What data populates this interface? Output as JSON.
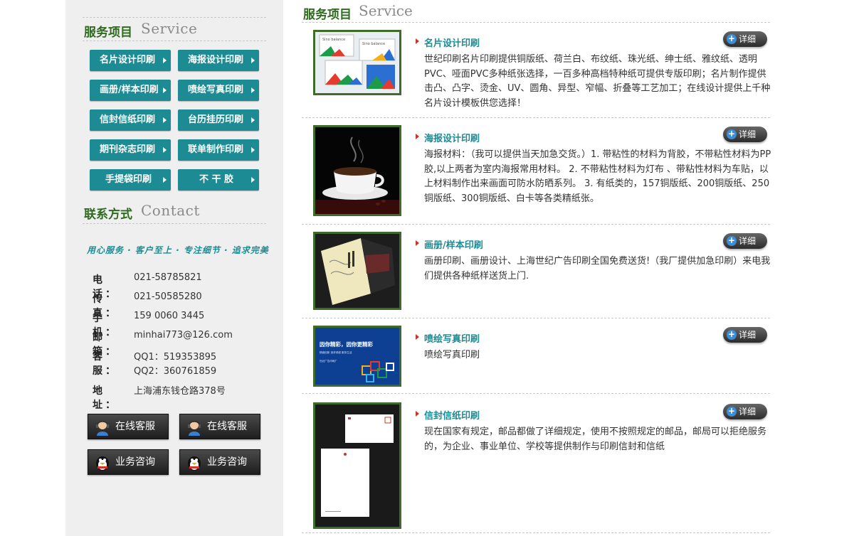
{
  "sidebar": {
    "services_cn": "服务项目",
    "services_en": "Service",
    "service_buttons": [
      "名片设计印刷",
      "海报设计印刷",
      "画册/样本印刷",
      "喷绘写真印刷",
      "信封信纸印刷",
      "台历挂历印刷",
      "期刊杂志印刷",
      "联单制作印刷",
      "手提袋印刷",
      "不 干 胶"
    ],
    "contact_cn": "联系方式",
    "contact_en": "Contact",
    "slogan": "用心服务 · 客户至上 · 专注细节 · 追求完美",
    "contact": {
      "phone_label": "电 话：",
      "phone": "021-58785821",
      "fax_label": "传 真：",
      "fax": "021-50585280",
      "mobile_label": "手 机：",
      "mobile": "159 0060 3445",
      "email_label": "邮 箱：",
      "email": "minhai773@126.com",
      "cs_label": "客 服：",
      "qq1": "QQ1：519353895",
      "qq2": "QQ2：360761859",
      "address_label": "地 址：",
      "address": "上海浦东钱仓路378号"
    },
    "cs_buttons": [
      "在线客服",
      "在线客服",
      "业务咨询",
      "业务咨询"
    ]
  },
  "main": {
    "head_cn": "服务项目",
    "head_en": "Service",
    "detail_label": "详细",
    "items": [
      {
        "title": "名片设计印刷",
        "desc": "世纪印刷名片印刷提供铜版纸、荷兰白、布纹纸、珠光纸、绅士纸、雅纹纸、透明PVC、哑面PVC多种纸张选择，一百多种高档特种纸可提供专版印刷；名片制作提供击凸、凸字、烫金、UV、圆角、异型、窄幅、折叠等工艺加工；在线设计提供上千种名片设计模板供您选择！"
      },
      {
        "title": "海报设计印刷",
        "desc": "海报材料：（我可以提供当天加急交货。）1. 带粘性的材料为背胶，不带粘性材料为PP胶,以上两者为室内海报常用材料。 2. 不带粘性材料为灯布 、带粘性材料为车贴，以上材料制作出来画面可防水防晒系列。 3. 有纸类的，157铜版纸、200铜版纸、250铜版纸、300铜版纸、白卡等各类精纸张。"
      },
      {
        "title": "画册/样本印刷",
        "desc": "画册印刷、画册设计、上海世纪广告印刷全国免费送货!（我厂提供加急印刷）来电我们提供各种纸样送货上门."
      },
      {
        "title": "喷绘写真印刷",
        "desc": "喷绘写真印刷"
      },
      {
        "title": "信封信纸印刷",
        "desc": "现在国家有规定，邮品都做了详细规定，使用不按照规定的邮品，邮局可以拒绝服务的，为企业、事业单位、学校等提供制作与印刷信封和信纸"
      }
    ],
    "thumb_texts": {
      "card_text": "Sino balance",
      "poster_text_1": "因你精彩，因你更精彩",
      "poster_text_2": "精细创新 追求卓越 服务生活",
      "poster_text_3": "世纪广告印刷厂"
    }
  },
  "colors": {
    "accent_teal": "#1c8b93",
    "heading_green": "#2f6b1f",
    "frame_green": "#3e6b2a"
  }
}
